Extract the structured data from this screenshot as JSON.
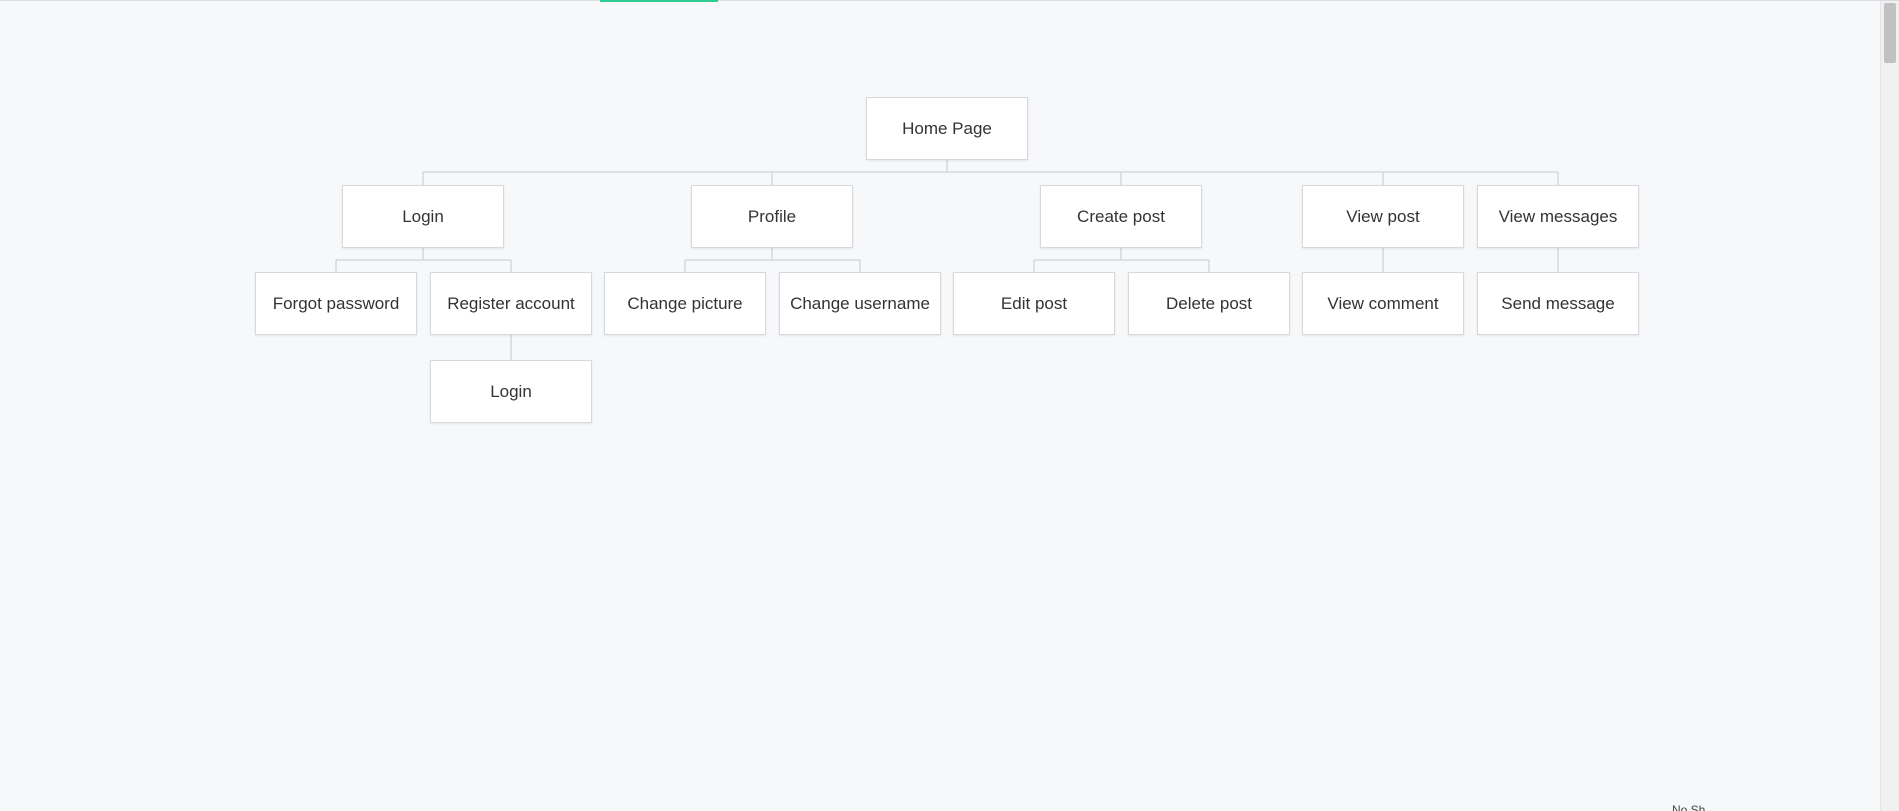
{
  "diagram": {
    "nodes": {
      "home": "Home Page",
      "login": "Login",
      "profile": "Profile",
      "create_post": "Create post",
      "view_post": "View post",
      "view_messages": "View messages",
      "forgot_password": "Forgot password",
      "register_account": "Register account",
      "change_picture": "Change picture",
      "change_username": "Change username",
      "edit_post": "Edit post",
      "delete_post": "Delete post",
      "view_comment": "View comment",
      "send_message": "Send message",
      "register_login": "Login"
    },
    "colors": {
      "background": "#f7f8fa",
      "node_border": "#d6d8dc",
      "connector": "#c5c8cd",
      "accent": "#2ecc8f"
    }
  },
  "footer": {
    "corner_text": "No Sh..."
  }
}
